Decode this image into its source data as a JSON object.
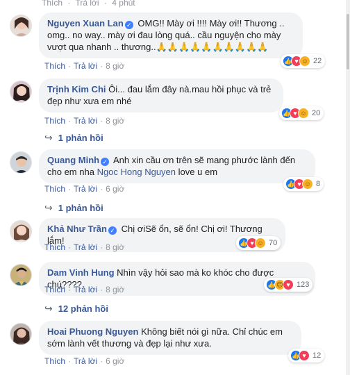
{
  "top_meta": {
    "like": "Thích",
    "reply": "Trả lời",
    "time": "4 phút"
  },
  "actions": {
    "like": "Thích",
    "reply": "Trả lời"
  },
  "comments": [
    {
      "author": "Nguyen Xuan Lan",
      "text": "OMG!! Mày ơi !!!! Mày ơi!! Thương .. omg.. no way.. mày ơi đau lòng quá.. cầu nguyện cho mày vượt qua nhanh .. thương..🙏🙏🙏🙏🙏🙏🙏🙏🙏🙏",
      "time": "8 giờ",
      "reactions": [
        "like-icon",
        "love-icon",
        "care-icon"
      ],
      "reaction_count": "22"
    },
    {
      "author": "Trịnh Kim Chi",
      "text": "Ôi... đau lắm đây nà.mau hồi phục và trẻ đẹp như xưa em nhé",
      "time": "8 giờ",
      "reactions": [
        "like-icon",
        "love-icon",
        "care-icon"
      ],
      "reaction_count": "20",
      "replies": "1 phản hồi"
    },
    {
      "author": "Quang Minh",
      "text": "Anh xin cầu ơn trên sẽ mang phước lành đến cho em nha",
      "mention": "Ngoc Hong Nguyen",
      "text_after": "love u em",
      "time": "6 giờ",
      "reactions": [
        "like-icon",
        "love-icon",
        "care-icon"
      ],
      "reaction_count": "8",
      "replies": "1 phản hồi"
    },
    {
      "author": "Khả Như Trần",
      "text": "Chị ơiSẽ ổn, sẽ ổn! Chị ơi! Thương lắm!",
      "time": "8 giờ",
      "reactions": [
        "like-icon",
        "love-icon",
        "care-icon"
      ],
      "reaction_count": "70"
    },
    {
      "author": "Dam Vinh Hung",
      "text": "Nhìn vậy hỏi sao mà ko khóc cho được chú????",
      "time": "8 giờ",
      "reactions": [
        "like-icon",
        "sad-icon",
        "love-icon"
      ],
      "reaction_count": "123",
      "replies": "12 phản hồi"
    },
    {
      "author": "Hoai Phuong Nguyen",
      "text": "Không biết nói gì nữa. Chỉ chúc em sớm lành vết thương và đẹp lại như xưa.",
      "time": "6 giờ",
      "reactions": [
        "like-icon",
        "love-icon"
      ],
      "reaction_count": "12"
    }
  ],
  "colors": {
    "link": "#385898",
    "meta": "#90949c",
    "bubble": "#f2f3f5",
    "like": "#1877f2",
    "love": "#f33e58",
    "care": "#f7b125"
  }
}
